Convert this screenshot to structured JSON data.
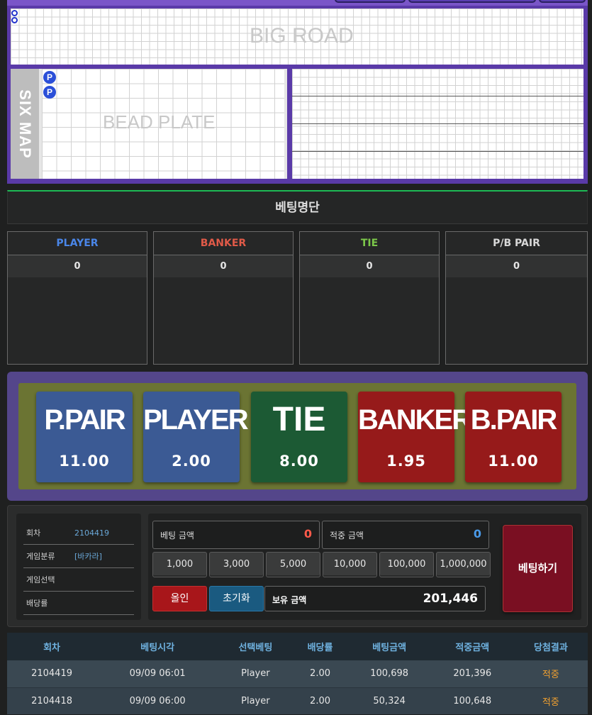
{
  "roads": {
    "big_road_label": "BIG ROAD",
    "six_map_label": "SIX MAP",
    "bead_plate_label": "BEAD PLATE",
    "bead_chip_letter": "P"
  },
  "bet_list": {
    "title": "베팅명단",
    "columns": [
      {
        "label": "PLAYER",
        "count": "0",
        "color": "#4a86e8"
      },
      {
        "label": "BANKER",
        "count": "0",
        "color": "#e05a48"
      },
      {
        "label": "TIE",
        "count": "0",
        "color": "#7cc84a"
      },
      {
        "label": "P/B PAIR",
        "count": "0",
        "color": "#d8d8d8"
      }
    ]
  },
  "bet_options": [
    {
      "label": "P.PAIR",
      "odds": "11.00",
      "color": "#3b5a94"
    },
    {
      "label": "PLAYER",
      "odds": "2.00",
      "color": "#3b5a94"
    },
    {
      "label": "TIE",
      "odds": "8.00",
      "color": "#1c5a34"
    },
    {
      "label": "BANKER",
      "odds": "1.95",
      "color": "#961a1a"
    },
    {
      "label": "B.PAIR",
      "odds": "11.00",
      "color": "#961a1a"
    }
  ],
  "info": {
    "round_label": "회차",
    "round_value": "2104419",
    "category_label": "게임분류",
    "category_value": "[바카라]",
    "selection_label": "게임선택",
    "selection_value": "",
    "odds_label": "배당률",
    "odds_value": ""
  },
  "betting": {
    "bet_amount_label": "베팅 금액",
    "bet_amount_value": "0",
    "win_amount_label": "적중 금액",
    "win_amount_value": "0",
    "chips": [
      "1,000",
      "3,000",
      "5,000",
      "10,000",
      "100,000",
      "1,000,000"
    ],
    "all_in_label": "올인",
    "reset_label": "초기화",
    "balance_label": "보유 금액",
    "balance_value": "201,446",
    "submit_label": "베팅하기"
  },
  "history": {
    "headers": [
      "회차",
      "베팅시각",
      "선택베팅",
      "배당률",
      "베팅금액",
      "적중금액",
      "당첨결과"
    ],
    "rows": [
      [
        "2104419",
        "09/09 06:01",
        "Player",
        "2.00",
        "100,698",
        "201,396",
        "적중"
      ],
      [
        "2104418",
        "09/09 06:00",
        "Player",
        "2.00",
        "50,324",
        "100,648",
        "적중"
      ]
    ]
  }
}
